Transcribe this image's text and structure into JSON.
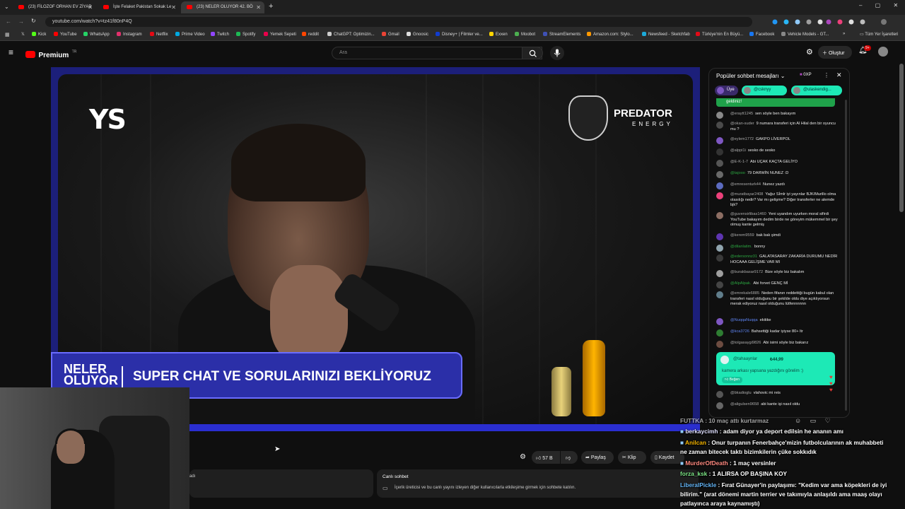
{
  "browser": {
    "tabs": [
      {
        "title": "(23) FİLOZOF ORHAN EV ZİYAR"
      },
      {
        "title": "İşte Felaket Pakistan Sokak Le"
      },
      {
        "title": "(23) NELER OLUYOR 42. BÖ"
      }
    ],
    "url": "youtube.com/watch?v=tz41f80nP4Q",
    "bookmarks": [
      "Kick",
      "YouTube",
      "WhatsApp",
      "Instagram",
      "Netflix",
      "Prime Video",
      "Twitch",
      "Spotify",
      "Yemek Sepeti",
      "reddit",
      "ChatGPT: Optimizin...",
      "Gmail",
      "Gnoosic",
      "Disney+ | Filmler ve...",
      "Exxen",
      "Moobot",
      "StreamElements",
      "Amazon.com: Stylo...",
      "Newsfeed - Sketchfab",
      "Türkiye'nin En Büyü...",
      "Facebook",
      "Vehicle Models - GT..."
    ],
    "all_bookmarks": "Tüm Yer İşaretleri"
  },
  "youtube": {
    "logo": "Premium",
    "logo_sup": "TR",
    "search_placeholder": "Ara",
    "create_label": "Oluştur",
    "notif_count": "9+"
  },
  "video": {
    "channel_logo": "YS",
    "sponsor": "PREDATOR",
    "sponsor_sub": "ENERGY",
    "show_name": "NELER OLUYOR",
    "lower_third": "SUPER CHAT VE SORULARINIZI BEKLİYORUZ",
    "can_label": "PREDATOR"
  },
  "actions": {
    "likes": "57 B",
    "share": "Paylaş",
    "clip": "Klip",
    "save": "Kaydet"
  },
  "below": {
    "left_label": "adı",
    "live_chat_title": "Canlı sohbet",
    "live_chat_text": "İçerik üreticisi ve bu canlı yayını izleyen diğer kullanıcılarla etkileşime girmek için sohbete katılın."
  },
  "chat": {
    "header": "Popüler sohbet mesajları",
    "points": "0XP",
    "chips": [
      "Üye",
      "@csknyy",
      "@ulaskendig..."
    ],
    "welcome": "geldiniz!",
    "messages": [
      {
        "user": "@eraytt1245",
        "text": "sen söyle ben bakayım",
        "color": "#8a8a8a"
      },
      {
        "user": "@okan-suder",
        "text": "9 numara transferi için Al Hilal den bir oyuncu mu ?",
        "color": "#4a4a4a"
      },
      {
        "user": "@eylem1772",
        "text": "GAKPO LİVERPOL",
        "color": "#7e57c2"
      },
      {
        "user": "@alppi1i",
        "text": "sesko de sesko",
        "color": "#333333"
      },
      {
        "user": "@E-K-1-7",
        "text": "Abi UÇAK KAÇTA GELİYO",
        "color": "#555555"
      },
      {
        "user": "@tajooo",
        "text": "79 DARWİN NUNEZ :D",
        "color": "#6a6a6a",
        "style": "green"
      },
      {
        "user": "@emresenturk44",
        "text": "Nunez yazdı",
        "color": "#5c6bc0"
      },
      {
        "user": "@muratbayar2408",
        "text": "Yağız Sİmlr iyi yayınlar BJK/Murillo olma olasılığı nedir? Var mı gelişme? Diğer transferler ne alemde bjk?",
        "color": "#ec407a"
      },
      {
        "user": "@guvensirlibas1460",
        "text": "Yeni uyandım uyurken moral sifirdi YouTube bakayım dedim birde ne göreyim mükemmel bir şey olmuş kante gelmiş",
        "color": "#8d6e63"
      },
      {
        "user": "@kerem9559",
        "text": "bak bak şimdi",
        "color": "#5e35b1"
      },
      {
        "user": "@dilanlatim.",
        "text": "bonny",
        "color": "#90a4ae",
        "style": "green"
      },
      {
        "user": "@edersonnz31",
        "text": "GALATASARAY ZAKARİA DURUMU NEDİR HOCAAA GELİŞME VAR MI",
        "color": "#3a3a3a",
        "style": "green"
      },
      {
        "user": "@burakbasar9172",
        "text": "Bize söyle biz bakalım",
        "color": "#9e9e9e"
      },
      {
        "user": "@AlpAlpak.",
        "text": "Abi forvet GENÇ Mİ",
        "color": "#444444",
        "style": "green"
      },
      {
        "user": "@emrekale6885",
        "text": "Neden fifanın reddettiği bugün kabul olan transferi nasıl olduğunu bir şekilde oldu diye açıklıyorsun merak ediyoruz nasıl olduğunu lütfennnnnn",
        "color": "#607d8b"
      },
      {
        "user": "@NuqqaNuqqa",
        "text": "ekitike",
        "color": "#7e57c2",
        "style": "blue"
      },
      {
        "user": "@kca3726",
        "text": "Bahsettiği kadar iyiyse 80+ ltr",
        "color": "#2e7d32",
        "style": "blue"
      },
      {
        "user": "@tolgasaygi9826",
        "text": "Abi isimi söyle biz bakarız",
        "color": "#6d4c41"
      },
      {
        "user": "@bkadioglu",
        "text": "vlahovic mi reis",
        "color": "#555555"
      },
      {
        "user": "@aligulsen9658",
        "text": "abi kante işi nasıl oldu",
        "color": "#666666"
      }
    ],
    "superchat": {
      "user": "@tahaaynlar",
      "amount": "₺44,99",
      "text": "kamera arkası yapsana yazdığını görelim :)",
      "badge": "Beğen"
    }
  },
  "overlay_chat": [
    {
      "name": "FUTTKA",
      "text": ": 10 maç attı kurtarmaz",
      "name_color": "#ffffff"
    },
    {
      "name": "berkaycimh",
      "text": ": adam diyor ya deport edilsin he ananın amı",
      "name_color": "#ffffff"
    },
    {
      "name": "Anilcan",
      "text": ": Onur turpanın Fenerbahçe'mizin futbolcularının ak muhabbeti",
      "name_color": "#f4b400"
    },
    {
      "name": "",
      "text": "ne zaman bitecek taktı bizimkilerin çüke sokkıdık",
      "name_color": "#ffffff"
    },
    {
      "name": "MurderOfDeath",
      "text": ": 1 maç versinler",
      "name_color": "#ff8a80"
    },
    {
      "name": "forza_ksk",
      "text": ": 1 ALIRSA OP BAŞINA KOY",
      "name_color": "#7ee787"
    },
    {
      "name": "LiberalPickle",
      "text": ": Fırat Günayer'in paylaşımı: \"Kedim var ama köpekleri de iyi",
      "name_color": "#64b5f6"
    },
    {
      "name": "",
      "text": "bilirim.\" (arat dönemi martin terrier ve takımıyla anlaşıldı ama maaş olayı",
      "name_color": "#ffffff"
    },
    {
      "name": "",
      "text": "patlayınca araya kaynamıştı)",
      "name_color": "#ffffff"
    }
  ],
  "colors": {
    "yt_red": "#ff0000",
    "stream_blue": "#2b2fa8",
    "superchat": "#1de9b6",
    "green_chip": "#1fa24a"
  }
}
